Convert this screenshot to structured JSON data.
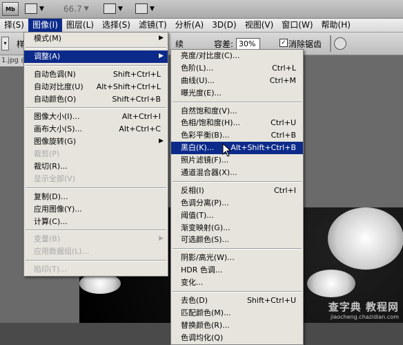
{
  "app_bar": {
    "mb_button": "Mb",
    "zoom": "66.7",
    "dropdown_arrow": "▼"
  },
  "menubar": [
    {
      "label": "择(S)",
      "active": false
    },
    {
      "label": "图像(I)",
      "active": true
    },
    {
      "label": "图层(L)",
      "active": false
    },
    {
      "label": "选择(S)",
      "active": false
    },
    {
      "label": "滤镜(T)",
      "active": false
    },
    {
      "label": "分析(A)",
      "active": false
    },
    {
      "label": "3D(D)",
      "active": false
    },
    {
      "label": "视图(V)",
      "active": false
    },
    {
      "label": "窗口(W)",
      "active": false
    },
    {
      "label": "帮助(H)",
      "active": false
    }
  ],
  "options_bar": {
    "sample_text": "续",
    "tolerance_label": "容差:",
    "tolerance_value": "30%",
    "antialias_label": "消除锯齿",
    "antialias_checked": "✓",
    "left_text": "样"
  },
  "document_tab": "1.jpg @",
  "image_menu": {
    "items": [
      {
        "label": "模式(M)",
        "shortcut": "",
        "submenu": true,
        "state": "normal"
      },
      {
        "separator": true
      },
      {
        "label": "调整(A)",
        "shortcut": "",
        "submenu": true,
        "state": "highlighted"
      },
      {
        "separator": true
      },
      {
        "label": "自动色调(N)",
        "shortcut": "Shift+Ctrl+L",
        "state": "normal"
      },
      {
        "label": "自动对比度(U)",
        "shortcut": "Alt+Shift+Ctrl+L",
        "state": "normal"
      },
      {
        "label": "自动颜色(O)",
        "shortcut": "Shift+Ctrl+B",
        "state": "normal"
      },
      {
        "separator": true
      },
      {
        "label": "图像大小(I)...",
        "shortcut": "Alt+Ctrl+I",
        "state": "normal"
      },
      {
        "label": "画布大小(S)...",
        "shortcut": "Alt+Ctrl+C",
        "state": "normal"
      },
      {
        "label": "图像旋转(G)",
        "shortcut": "",
        "submenu": true,
        "state": "normal"
      },
      {
        "label": "裁剪(P)",
        "shortcut": "",
        "state": "disabled"
      },
      {
        "label": "裁切(R)...",
        "shortcut": "",
        "state": "normal"
      },
      {
        "label": "显示全部(V)",
        "shortcut": "",
        "state": "disabled"
      },
      {
        "separator": true
      },
      {
        "label": "复制(D)...",
        "shortcut": "",
        "state": "normal"
      },
      {
        "label": "应用图像(Y)...",
        "shortcut": "",
        "state": "normal"
      },
      {
        "label": "计算(C)...",
        "shortcut": "",
        "state": "normal"
      },
      {
        "separator": true
      },
      {
        "label": "变量(B)",
        "shortcut": "",
        "submenu": true,
        "state": "disabled"
      },
      {
        "label": "应用数据组(L)...",
        "shortcut": "",
        "state": "disabled"
      },
      {
        "separator": true
      },
      {
        "label": "陷印(T)...",
        "shortcut": "",
        "state": "disabled"
      }
    ]
  },
  "adjust_menu": {
    "items": [
      {
        "label": "亮度/对比度(C)...",
        "shortcut": "",
        "state": "normal"
      },
      {
        "label": "色阶(L)...",
        "shortcut": "Ctrl+L",
        "state": "normal"
      },
      {
        "label": "曲线(U)...",
        "shortcut": "Ctrl+M",
        "state": "normal"
      },
      {
        "label": "曝光度(E)...",
        "shortcut": "",
        "state": "normal"
      },
      {
        "separator": true
      },
      {
        "label": "自然饱和度(V)...",
        "shortcut": "",
        "state": "normal"
      },
      {
        "label": "色相/饱和度(H)...",
        "shortcut": "Ctrl+U",
        "state": "normal"
      },
      {
        "label": "色彩平衡(B)...",
        "shortcut": "Ctrl+B",
        "state": "normal"
      },
      {
        "label": "黑白(K)...",
        "shortcut": "Alt+Shift+Ctrl+B",
        "state": "highlighted"
      },
      {
        "label": "照片滤镜(F)...",
        "shortcut": "",
        "state": "normal"
      },
      {
        "label": "通道混合器(X)...",
        "shortcut": "",
        "state": "normal"
      },
      {
        "separator": true
      },
      {
        "label": "反相(I)",
        "shortcut": "Ctrl+I",
        "state": "normal"
      },
      {
        "label": "色调分离(P)...",
        "shortcut": "",
        "state": "normal"
      },
      {
        "label": "阈值(T)...",
        "shortcut": "",
        "state": "normal"
      },
      {
        "label": "渐变映射(G)...",
        "shortcut": "",
        "state": "normal"
      },
      {
        "label": "可选颜色(S)...",
        "shortcut": "",
        "state": "normal"
      },
      {
        "separator": true
      },
      {
        "label": "阴影/高光(W)...",
        "shortcut": "",
        "state": "normal"
      },
      {
        "label": "HDR 色调...",
        "shortcut": "",
        "state": "normal"
      },
      {
        "label": "变化...",
        "shortcut": "",
        "state": "normal"
      },
      {
        "separator": true
      },
      {
        "label": "去色(D)",
        "shortcut": "Shift+Ctrl+U",
        "state": "normal"
      },
      {
        "label": "匹配颜色(M)...",
        "shortcut": "",
        "state": "normal"
      },
      {
        "label": "替换颜色(R)...",
        "shortcut": "",
        "state": "normal"
      },
      {
        "label": "色调均化(Q)",
        "shortcut": "",
        "state": "normal"
      }
    ]
  },
  "watermark": {
    "line1": "查字典 教程网",
    "line2": "jiaocheng.chazidian.com"
  },
  "colors": {
    "highlight": "#0c2a8a",
    "menu_bg": "#e6e4dd"
  }
}
